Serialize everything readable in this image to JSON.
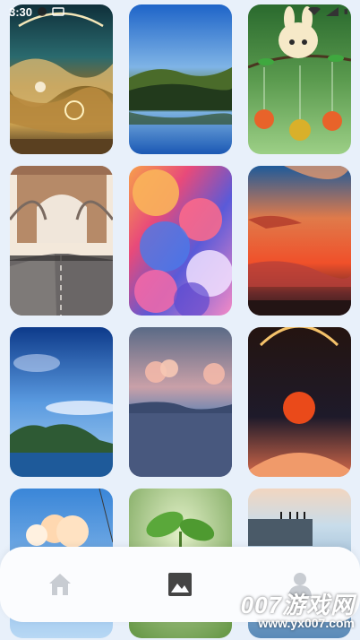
{
  "status_bar": {
    "time": "3:30"
  },
  "wallpapers": [
    {
      "id": "golden-swirl-moon"
    },
    {
      "id": "mountain-lake-reflection"
    },
    {
      "id": "bunny-mascot-fruits"
    },
    {
      "id": "suspension-bridge"
    },
    {
      "id": "colorful-clouds"
    },
    {
      "id": "red-sunset-sky"
    },
    {
      "id": "blue-sky-island"
    },
    {
      "id": "pink-clouds-sea"
    },
    {
      "id": "red-sun-eclipse"
    },
    {
      "id": "sky-clouds-street"
    },
    {
      "id": "green-sprout"
    },
    {
      "id": "people-on-cliff"
    }
  ],
  "nav": {
    "items": [
      {
        "name": "home",
        "icon": "home-icon",
        "active": false
      },
      {
        "name": "gallery",
        "icon": "image-icon",
        "active": true
      },
      {
        "name": "profile",
        "icon": "person-icon",
        "active": false
      }
    ],
    "colors": {
      "inactive": "#c8ccd2",
      "active": "#444444"
    }
  },
  "watermark": {
    "main": "007游戏网",
    "sub": "www.yx007.com"
  }
}
